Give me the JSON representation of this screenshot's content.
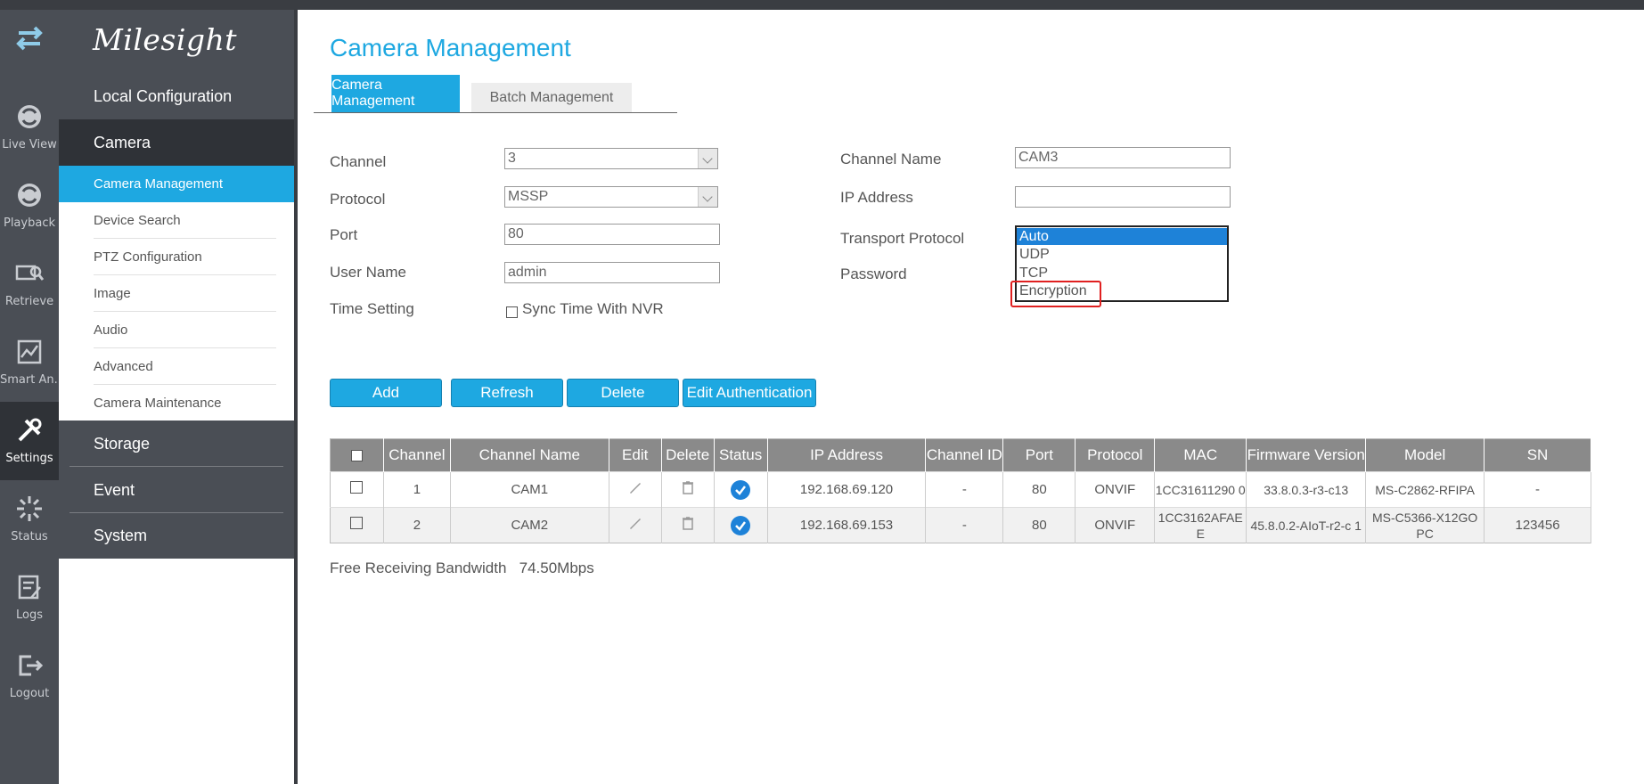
{
  "iconbar": {
    "items": [
      {
        "label": "",
        "icon": "switch-arrows-icon"
      },
      {
        "label": "Live View",
        "icon": "live-view-icon"
      },
      {
        "label": "Playback",
        "icon": "playback-icon"
      },
      {
        "label": "Retrieve",
        "icon": "retrieve-icon"
      },
      {
        "label": "Smart An...",
        "icon": "smart-analysis-icon"
      },
      {
        "label": "Settings",
        "icon": "settings-icon",
        "active": true
      },
      {
        "label": "Status",
        "icon": "status-icon"
      },
      {
        "label": "Logs",
        "icon": "logs-icon"
      },
      {
        "label": "Logout",
        "icon": "logout-icon"
      }
    ]
  },
  "nav": {
    "logo": "Milesight",
    "groups": {
      "local": "Local Configuration",
      "camera": "Camera",
      "storage": "Storage",
      "event": "Event",
      "system": "System"
    },
    "camera_items": [
      "Camera Management",
      "Device Search",
      "PTZ Configuration",
      "Image",
      "Audio",
      "Advanced",
      "Camera Maintenance"
    ]
  },
  "main": {
    "title": "Camera Management",
    "tabs": [
      "Camera Management",
      "Batch Management"
    ],
    "form": {
      "channel_label": "Channel",
      "channel_value": "3",
      "protocol_label": "Protocol",
      "protocol_value": "MSSP",
      "port_label": "Port",
      "port_value": "80",
      "username_label": "User Name",
      "username_value": "admin",
      "time_label": "Time Setting",
      "sync_label": "Sync Time With NVR",
      "channel_name_label": "Channel Name",
      "channel_name_value": "CAM3",
      "ip_label": "IP Address",
      "ip_value": "",
      "transport_label": "Transport Protocol",
      "password_label": "Password",
      "transport_options": [
        "Auto",
        "UDP",
        "TCP",
        "Encryption"
      ],
      "transport_selected": "Auto"
    },
    "buttons": {
      "add": "Add",
      "refresh": "Refresh",
      "delete": "Delete",
      "edit_auth": "Edit Authentication"
    },
    "table": {
      "headers": [
        "",
        "Channel",
        "Channel Name",
        "Edit",
        "Delete",
        "Status",
        "IP Address",
        "Channel ID",
        "Port",
        "Protocol",
        "MAC",
        "Firmware Version",
        "Model",
        "SN"
      ],
      "rows": [
        {
          "channel": "1",
          "name": "CAM1",
          "ip": "192.168.69.120",
          "channel_id": "-",
          "port": "80",
          "protocol": "ONVIF",
          "mac": "1CC31611290 0",
          "firmware": "33.8.0.3-r3-c13",
          "model": "MS-C2862-RFIPA",
          "sn": "-"
        },
        {
          "channel": "2",
          "name": "CAM2",
          "ip": "192.168.69.153",
          "channel_id": "-",
          "port": "80",
          "protocol": "ONVIF",
          "mac": "1CC3162AFAE E",
          "firmware": "45.8.0.2-AIoT-r2-c 1",
          "model": "MS-C5366-X12GO PC",
          "sn": "123456"
        }
      ]
    },
    "bandwidth_label": "Free Receiving Bandwidth",
    "bandwidth_value": "74.50Mbps"
  },
  "colors": {
    "accent": "#1ea8e1",
    "sidebar_dark": "#4a4e55",
    "highlight": "#e02020"
  }
}
